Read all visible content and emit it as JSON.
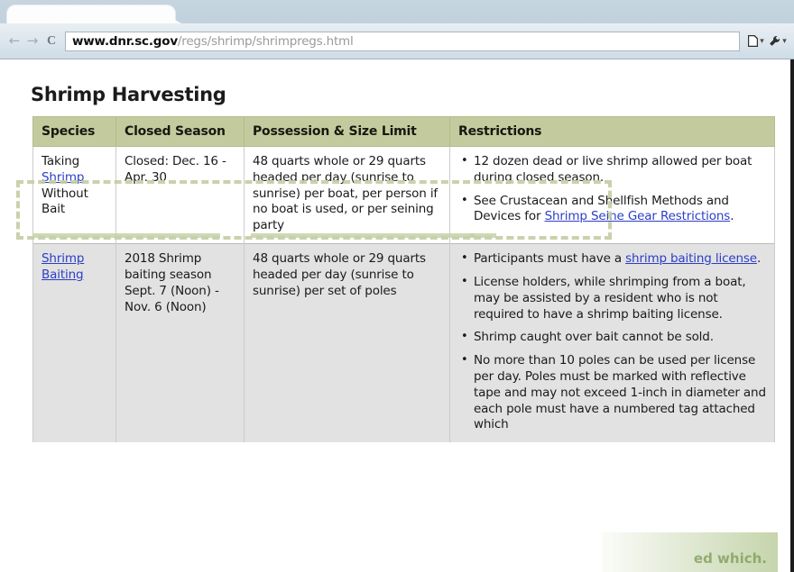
{
  "browser": {
    "tab_label": "",
    "back_icon": "back-arrow-icon",
    "forward_icon": "forward-arrow-icon",
    "reload_icon": "reload-icon",
    "url_domain": "www.dnr.sc.gov",
    "url_path": "/regs/shrimp/shrimpregs.html",
    "url_full": "www.dnr.sc.gov/regs/shrimp/shrimpregs.html",
    "page_menu_icon": "page-menu-icon",
    "tools_menu_icon": "wrench-tools-icon"
  },
  "page": {
    "title": "Shrimp Harvesting",
    "table": {
      "headers": [
        "Species",
        "Closed Season",
        "Possession & Size Limit",
        "Restrictions"
      ],
      "rows": [
        {
          "species_pre": "Taking ",
          "species_link": "Shrimp",
          "species_post": " Without Bait",
          "season": "Closed: Dec. 16 - Apr. 30",
          "limit": "48 quarts whole or 29 quarts headed per day (sunrise to sunrise) per boat, per person if no boat is used, or per seining party",
          "restrictions": [
            {
              "pre": "12 dozen dead or live shrimp allowed per boat during closed season.",
              "link": "",
              "post": ""
            },
            {
              "pre": "See Crustacean and Shellfish Methods and Devices for ",
              "link": "Shrimp Seine Gear Restrictions",
              "post": "."
            }
          ]
        },
        {
          "species_pre": "",
          "species_link": "Shrimp Baiting",
          "species_post": "",
          "season": "2018 Shrimp baiting season Sept. 7 (Noon) - Nov. 6 (Noon)",
          "limit": "48 quarts whole or 29 quarts headed per day (sunrise to sunrise) per set of poles",
          "restrictions": [
            {
              "pre": "Participants must have a ",
              "link": "shrimp baiting license",
              "post": "."
            },
            {
              "pre": "License holders, while shrimping from a boat, may be assisted by a resident who is not required to have a shrimp baiting license.",
              "link": "",
              "post": ""
            },
            {
              "pre": "Shrimp caught over bait cannot be sold.",
              "link": "",
              "post": ""
            },
            {
              "pre": "No more than 10 poles can be used per license per day. Poles must be marked with reflective tape and may not exceed 1-inch in diameter and each pole must have a numbered tag attached which",
              "link": "",
              "post": ""
            }
          ]
        }
      ]
    }
  },
  "overlay": {
    "watermark_text": "ed which.",
    "selection_color": "#c5cfa4",
    "header_color": "#c3cb9e",
    "link_color": "#2b3ec9"
  }
}
